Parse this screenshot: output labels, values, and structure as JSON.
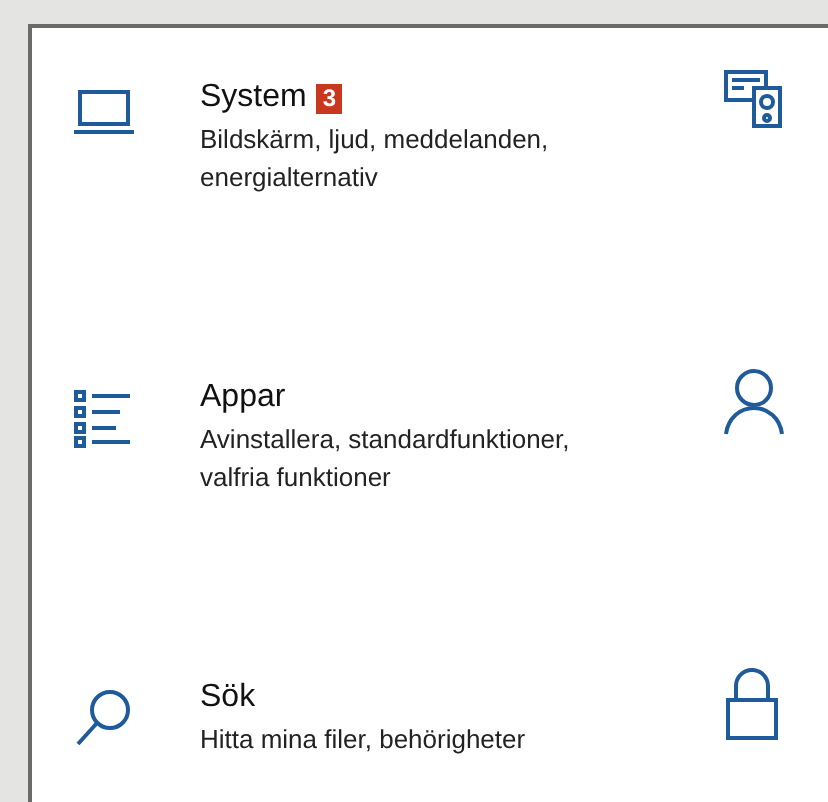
{
  "categories": [
    {
      "title": "System",
      "badge": "3",
      "description": "Bildskärm, ljud, meddelanden, energialternativ"
    },
    {
      "title": "Appar",
      "description": "Avinstallera, standardfunktioner, valfria funktioner"
    },
    {
      "title": "Sök",
      "description": "Hitta mina filer, behörigheter"
    }
  ]
}
